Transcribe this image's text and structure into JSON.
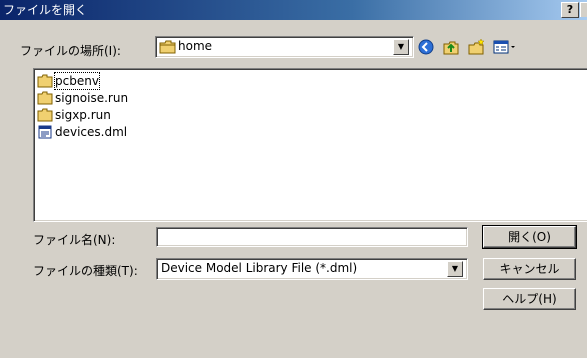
{
  "window": {
    "title": "ファイルを開く",
    "help_label": "?"
  },
  "location": {
    "label": "ファイルの場所(I):",
    "value": "home"
  },
  "toolbar": [
    {
      "name": "back-icon"
    },
    {
      "name": "up-folder-icon"
    },
    {
      "name": "new-folder-icon"
    },
    {
      "name": "view-menu-icon"
    }
  ],
  "files": [
    {
      "name": "pcbenv",
      "type": "folder"
    },
    {
      "name": "signoise.run",
      "type": "folder"
    },
    {
      "name": "sigxp.run",
      "type": "folder"
    },
    {
      "name": "devices.dml",
      "type": "file"
    }
  ],
  "filename": {
    "label": "ファイル名(N):",
    "value": ""
  },
  "filetype": {
    "label": "ファイルの種類(T):",
    "value": "Device Model Library File (*.dml)"
  },
  "buttons": {
    "open": "開く(O)",
    "cancel": "キャンセル",
    "help": "ヘルプ(H)"
  }
}
